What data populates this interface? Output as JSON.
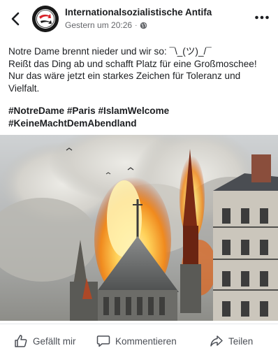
{
  "header": {
    "page_name": "Internationalsozialistische Antifa",
    "timestamp": "Gestern um 20:26",
    "separator": "·",
    "privacy_icon": "globe-icon",
    "back_icon": "chevron-left-icon",
    "more_icon": "more-horizontal-icon"
  },
  "post": {
    "line1": "Notre Dame brennt nieder und wir so: ¯\\_(ツ)_/¯",
    "line2": "Reißt das Ding ab und schafft Platz für eine Großmoschee!",
    "line3": "Nur das wäre jetzt ein starkes Zeichen für Toleranz und",
    "line4": "Vielfalt.",
    "hashtags": [
      "#NotreDame",
      "#Paris",
      "#IslamWelcome",
      "#KeineMachtDemAbendland"
    ]
  },
  "actions": {
    "like_label": "Gefällt mir",
    "comment_label": "Kommentieren",
    "share_label": "Teilen"
  },
  "colors": {
    "text": "#1c1e21",
    "secondary": "#65676b",
    "action": "#4b4f56",
    "antifa_red": "#d8232a"
  }
}
